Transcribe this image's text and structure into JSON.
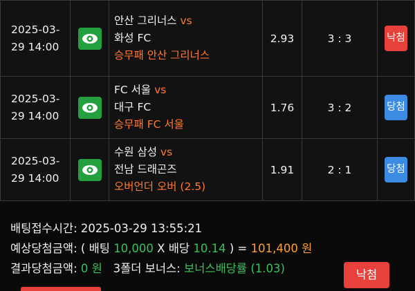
{
  "bets": [
    {
      "date_line1": "2025-03-",
      "date_line2": "29 14:00",
      "home": "안산 그리너스",
      "vs": "vs",
      "away": "화성 FC",
      "pick": "승무패 안산 그리너스",
      "odds": "2.93",
      "score": "3 : 3",
      "result": "낙첨",
      "result_type": "lose"
    },
    {
      "date_line1": "2025-03-",
      "date_line2": "29 14:00",
      "home": "FC 서울",
      "vs": "vs",
      "away": "대구 FC",
      "pick": "승무패 FC 서울",
      "odds": "1.76",
      "score": "3 : 2",
      "result": "당첨",
      "result_type": "win"
    },
    {
      "date_line1": "2025-03-",
      "date_line2": "29 14:00",
      "home": "수원 삼성",
      "vs": "vs",
      "away": "전남 드래곤즈",
      "pick": "오버언더 오버 (2.5)",
      "odds": "1.91",
      "score": "2 : 1",
      "result": "당첨",
      "result_type": "win"
    }
  ],
  "summary": {
    "receipt_label": "배팅접수시간:",
    "receipt_time": "2025-03-29 13:55:21",
    "expected_label": "예상당첨금액:",
    "open_paren": "( 배팅",
    "stake": "10,000",
    "times": "X",
    "odds_label": "배당",
    "total_odds": "10.14",
    "close_eq": ") =",
    "expected_amount": "101,400 원",
    "result_label": "결과당첨금액:",
    "result_amount": "0 원",
    "bonus_label": "3폴더 보너스:",
    "bonus_value": "보너스배당률 (1.03)",
    "final_result": "낙첨"
  },
  "colors": {
    "accent_orange": "#ff7a2e",
    "green": "#25a03f",
    "lose_red": "#e8413c",
    "win_blue": "#3b8ae3"
  },
  "icons": {
    "view": "eye-icon"
  }
}
